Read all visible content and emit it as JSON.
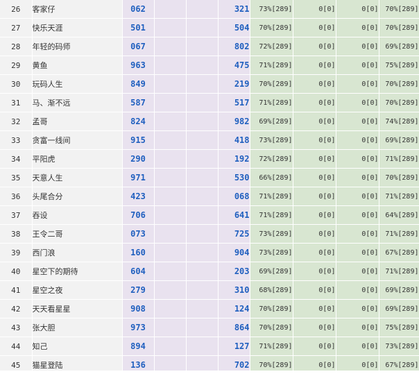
{
  "colors": {
    "rank_bg": "#f2f2f2",
    "num_bg": "#e9e2ef",
    "stat_bg": "#d8e6d1",
    "num_text": "#1f5fbf"
  },
  "rows": [
    {
      "rank": "26",
      "name": "客家仔",
      "num1": "062",
      "num2": "321",
      "s1": "73%[289]",
      "s2": "0[0]",
      "s3": "0[0]",
      "s4": "70%[289]"
    },
    {
      "rank": "27",
      "name": "快乐天涯",
      "num1": "501",
      "num2": "504",
      "s1": "70%[289]",
      "s2": "0[0]",
      "s3": "0[0]",
      "s4": "70%[289]"
    },
    {
      "rank": "28",
      "name": "年轻的码师",
      "num1": "067",
      "num2": "802",
      "s1": "72%[289]",
      "s2": "0[0]",
      "s3": "0[0]",
      "s4": "69%[289]"
    },
    {
      "rank": "29",
      "name": "黄鱼",
      "num1": "963",
      "num2": "475",
      "s1": "71%[289]",
      "s2": "0[0]",
      "s3": "0[0]",
      "s4": "75%[289]"
    },
    {
      "rank": "30",
      "name": "玩码人生",
      "num1": "849",
      "num2": "219",
      "s1": "70%[289]",
      "s2": "0[0]",
      "s3": "0[0]",
      "s4": "70%[289]"
    },
    {
      "rank": "31",
      "name": "马、渐不远",
      "num1": "587",
      "num2": "517",
      "s1": "71%[289]",
      "s2": "0[0]",
      "s3": "0[0]",
      "s4": "70%[289]"
    },
    {
      "rank": "32",
      "name": "孟哥",
      "num1": "824",
      "num2": "982",
      "s1": "69%[289]",
      "s2": "0[0]",
      "s3": "0[0]",
      "s4": "74%[289]"
    },
    {
      "rank": "33",
      "name": "贪富一线间",
      "num1": "915",
      "num2": "418",
      "s1": "73%[289]",
      "s2": "0[0]",
      "s3": "0[0]",
      "s4": "69%[289]"
    },
    {
      "rank": "34",
      "name": "平阳虎",
      "num1": "290",
      "num2": "192",
      "s1": "72%[289]",
      "s2": "0[0]",
      "s3": "0[0]",
      "s4": "71%[289]"
    },
    {
      "rank": "35",
      "name": "天意人生",
      "num1": "971",
      "num2": "530",
      "s1": "66%[289]",
      "s2": "0[0]",
      "s3": "0[0]",
      "s4": "70%[289]"
    },
    {
      "rank": "36",
      "name": "头尾合分",
      "num1": "423",
      "num2": "068",
      "s1": "71%[289]",
      "s2": "0[0]",
      "s3": "0[0]",
      "s4": "71%[289]"
    },
    {
      "rank": "37",
      "name": "吞设",
      "num1": "706",
      "num2": "641",
      "s1": "71%[289]",
      "s2": "0[0]",
      "s3": "0[0]",
      "s4": "64%[289]"
    },
    {
      "rank": "38",
      "name": "王令二哥",
      "num1": "073",
      "num2": "725",
      "s1": "73%[289]",
      "s2": "0[0]",
      "s3": "0[0]",
      "s4": "71%[289]"
    },
    {
      "rank": "39",
      "name": "西门浪",
      "num1": "160",
      "num2": "904",
      "s1": "73%[289]",
      "s2": "0[0]",
      "s3": "0[0]",
      "s4": "67%[289]"
    },
    {
      "rank": "40",
      "name": "星空下的期待",
      "num1": "604",
      "num2": "203",
      "s1": "69%[289]",
      "s2": "0[0]",
      "s3": "0[0]",
      "s4": "71%[289]"
    },
    {
      "rank": "41",
      "name": "星空之夜",
      "num1": "279",
      "num2": "310",
      "s1": "68%[289]",
      "s2": "0[0]",
      "s3": "0[0]",
      "s4": "69%[289]"
    },
    {
      "rank": "42",
      "name": "天天看星星",
      "num1": "908",
      "num2": "124",
      "s1": "70%[289]",
      "s2": "0[0]",
      "s3": "0[0]",
      "s4": "69%[289]"
    },
    {
      "rank": "43",
      "name": "张大胆",
      "num1": "973",
      "num2": "864",
      "s1": "70%[289]",
      "s2": "0[0]",
      "s3": "0[0]",
      "s4": "75%[289]"
    },
    {
      "rank": "44",
      "name": "知己",
      "num1": "894",
      "num2": "127",
      "s1": "71%[289]",
      "s2": "0[0]",
      "s3": "0[0]",
      "s4": "73%[289]"
    },
    {
      "rank": "45",
      "name": "猫星登陆",
      "num1": "136",
      "num2": "702",
      "s1": "70%[289]",
      "s2": "0[0]",
      "s3": "0[0]",
      "s4": "67%[289]"
    }
  ]
}
